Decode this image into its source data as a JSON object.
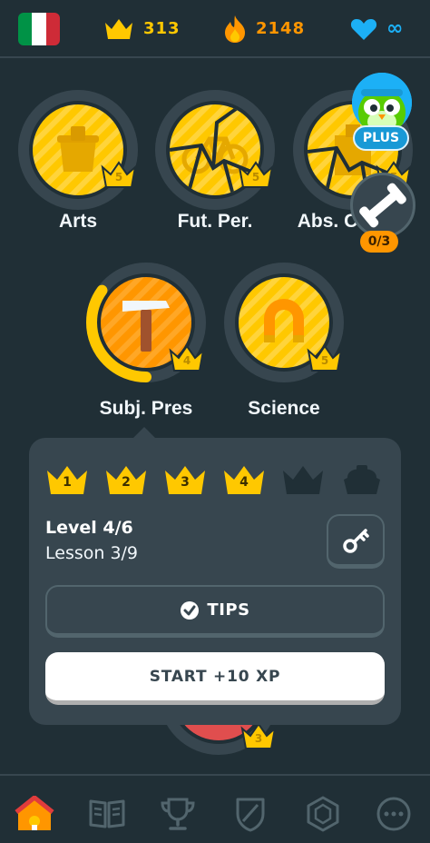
{
  "topbar": {
    "flag_colors": [
      "#009246",
      "#ffffff",
      "#ce2b37"
    ],
    "flag_icon": "italy-flag-icon",
    "crowns": "313",
    "streak": "2148",
    "hearts": "∞"
  },
  "skills": [
    {
      "name": "Arts",
      "crown_level": "5",
      "icon": "bucket-icon"
    },
    {
      "name": "Fut. Per.",
      "crown_level": "5",
      "icon": "bicycle-icon"
    },
    {
      "name": "Abs. C",
      "crown_level": "5",
      "icon": "building-icon"
    },
    {
      "name": "Subj. Pres",
      "crown_level": "4",
      "icon": "hammer-icon"
    },
    {
      "name": "Science",
      "crown_level": "5",
      "icon": "magnet-icon"
    }
  ],
  "plus": {
    "label": "PLUS",
    "icon": "owl-mascot-icon"
  },
  "practice": {
    "count": "0/3",
    "icon": "dumbbell-icon"
  },
  "popover": {
    "levels": [
      "1",
      "2",
      "3",
      "4",
      "",
      ""
    ],
    "completed_levels": 4,
    "level_title": "Level 4/6",
    "lesson_text": "Lesson 3/9",
    "tips_label": "TIPS",
    "start_label": "START +10 XP"
  },
  "peek_badge": "3",
  "subj_progress_fraction": 0.35,
  "nav": [
    "home-icon",
    "stories-book-icon",
    "leaderboard-trophy-icon",
    "shield-icon",
    "shop-gem-icon",
    "more-icon"
  ],
  "colors": {
    "gold": "#ffc800",
    "orange": "#ff9600",
    "blue": "#1cb0f6",
    "bg": "#202f36",
    "panel": "#37464f"
  }
}
